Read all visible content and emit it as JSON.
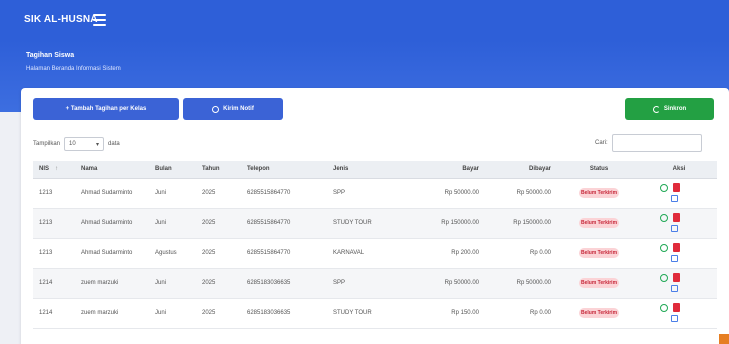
{
  "app": {
    "brand": "SIK AL-HUSNA"
  },
  "hero": {
    "title": "Tagihan Siswa",
    "subtitle": "Halaman Beranda Informasi Sistem"
  },
  "toolbar": {
    "add_label": "+ Tambah Tagihan per Kelas",
    "notif_label": "Kirim Notif",
    "sync_label": "Sinkron"
  },
  "controls": {
    "show_prefix": "Tampilkan",
    "show_value": "10",
    "show_suffix": "data",
    "search_label": "Cari:"
  },
  "table": {
    "headers": [
      "NIS",
      "Nama",
      "Bulan",
      "Tahun",
      "Telepon",
      "Jenis",
      "Bayar",
      "Dibayar",
      "Status",
      "Aksi"
    ],
    "rows": [
      {
        "nis": "1213",
        "nama": "Ahmad Sudarminto",
        "bulan": "Juni",
        "tahun": "2025",
        "telepon": "6285515864770",
        "jenis": "SPP",
        "bayar": "Rp 50000.00",
        "dibayar": "Rp 50000.00",
        "status": "Belum Terkirim"
      },
      {
        "nis": "1213",
        "nama": "Ahmad Sudarminto",
        "bulan": "Juni",
        "tahun": "2025",
        "telepon": "6285515864770",
        "jenis": "STUDY TOUR",
        "bayar": "Rp 150000.00",
        "dibayar": "Rp 150000.00",
        "status": "Belum Terkirim"
      },
      {
        "nis": "1213",
        "nama": "Ahmad Sudarminto",
        "bulan": "Agustus",
        "tahun": "2025",
        "telepon": "6285515864770",
        "jenis": "KARNAVAL",
        "bayar": "Rp 200.00",
        "dibayar": "Rp 0.00",
        "status": "Belum Terkirim"
      },
      {
        "nis": "1214",
        "nama": "zuem marzuki",
        "bulan": "Juni",
        "tahun": "2025",
        "telepon": "6285183036635",
        "jenis": "SPP",
        "bayar": "Rp 50000.00",
        "dibayar": "Rp 50000.00",
        "status": "Belum Terkirim"
      },
      {
        "nis": "1214",
        "nama": "zuem marzuki",
        "bulan": "Juni",
        "tahun": "2025",
        "telepon": "6285183036635",
        "jenis": "STUDY TOUR",
        "bayar": "Rp 150.00",
        "dibayar": "Rp 0.00",
        "status": "Belum Terkirim"
      }
    ]
  }
}
